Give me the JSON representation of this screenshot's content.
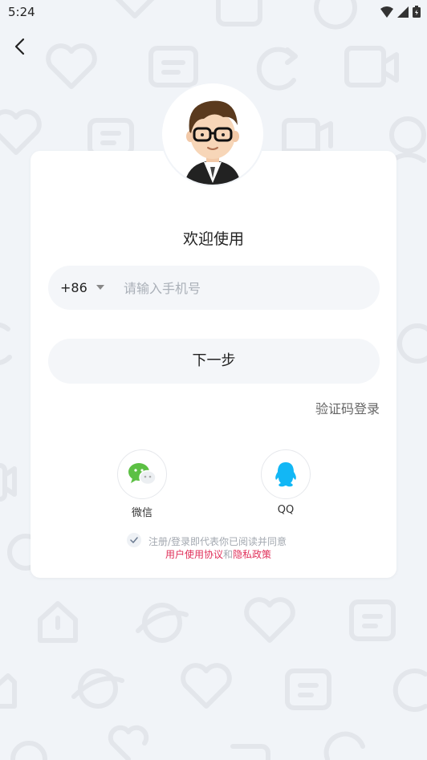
{
  "status_bar": {
    "time": "5:24"
  },
  "header": {
    "back_icon": "chevron-left-icon"
  },
  "login": {
    "welcome": "欢迎使用",
    "country_code": "+86",
    "phone_placeholder": "请输入手机号",
    "next_label": "下一步",
    "sms_login_label": "验证码登录"
  },
  "social": [
    {
      "label": "微信",
      "icon": "wechat-icon"
    },
    {
      "label": "QQ",
      "icon": "qq-icon"
    }
  ],
  "agreement": {
    "prefix": "注册/登录即代表你已阅读并同意",
    "user_agreement": "用户使用协议",
    "and": "和",
    "privacy_policy": "隐私政策"
  },
  "colors": {
    "background": "#f1f4f8",
    "link": "#e0305a",
    "wechat": "#5cc044",
    "qq": "#12b7f5"
  }
}
